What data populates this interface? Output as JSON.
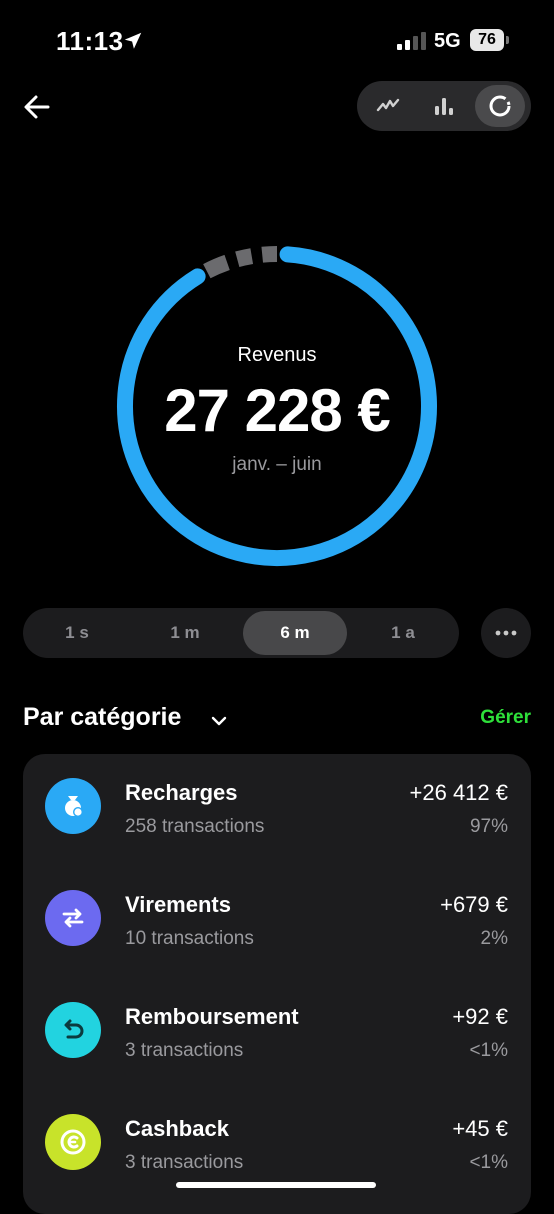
{
  "status": {
    "time": "11:13",
    "network": "5G",
    "battery": "76"
  },
  "header": {
    "view_modes": [
      {
        "icon": "line-chart-icon",
        "active": false
      },
      {
        "icon": "bar-chart-icon",
        "active": false
      },
      {
        "icon": "donut-chart-icon",
        "active": true
      }
    ]
  },
  "summary": {
    "label": "Revenus",
    "amount": "27 228 €",
    "period": "janv. – juin"
  },
  "chart_data": {
    "type": "pie",
    "categories": [
      "Recharges",
      "Virements",
      "Remboursement",
      "Cashback"
    ],
    "values": [
      26412,
      679,
      92,
      45
    ],
    "colors": [
      "#2aa9f5",
      "#6c6af0",
      "#22d3e0",
      "#c8e32a"
    ]
  },
  "periods": [
    {
      "label": "1 s",
      "active": false
    },
    {
      "label": "1 m",
      "active": false
    },
    {
      "label": "6 m",
      "active": true
    },
    {
      "label": "1 a",
      "active": false
    }
  ],
  "more_label": "•••",
  "section": {
    "title": "Par catégorie",
    "manage_label": "Gérer"
  },
  "categories": [
    {
      "name": "Recharges",
      "count": "258 transactions",
      "amount": "+26 412 €",
      "pct": "97%",
      "color": "#2aa9f5",
      "icon": "coins-icon"
    },
    {
      "name": "Virements",
      "count": "10 transactions",
      "amount": "+679 €",
      "pct": "2%",
      "color": "#6c6af0",
      "icon": "transfer-arrows-icon"
    },
    {
      "name": "Remboursement",
      "count": "3 transactions",
      "amount": "+92 €",
      "pct": "<1%",
      "color": "#22d3e0",
      "icon": "refund-icon"
    },
    {
      "name": "Cashback",
      "count": "3 transactions",
      "amount": "+45 €",
      "pct": "<1%",
      "color": "#c8e32a",
      "icon": "cashback-icon"
    }
  ]
}
